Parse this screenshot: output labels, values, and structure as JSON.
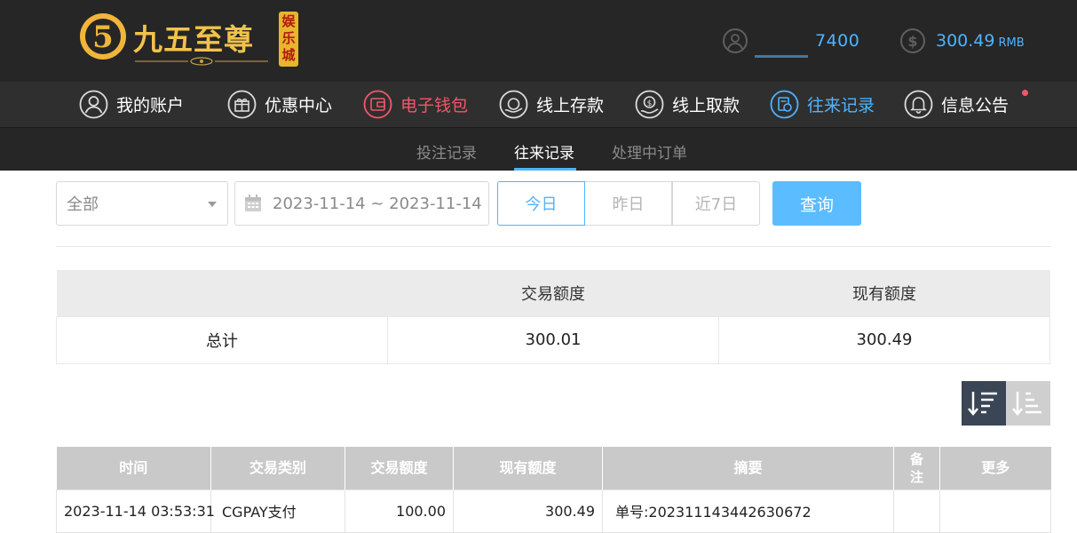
{
  "header": {
    "logo_text": "九五至尊",
    "logo_badge": "娱乐城",
    "username_visible": "7400",
    "balance": "300.49",
    "currency": "RMB"
  },
  "nav": {
    "items": [
      {
        "label": "我的账户",
        "icon": "user-circle-icon"
      },
      {
        "label": "优惠中心",
        "icon": "gift-icon"
      },
      {
        "label": "电子钱包",
        "icon": "wallet-icon",
        "color": "#f4566b"
      },
      {
        "label": "线上存款",
        "icon": "deposit-icon"
      },
      {
        "label": "线上取款",
        "icon": "withdraw-icon"
      },
      {
        "label": "往来记录",
        "icon": "records-icon",
        "color": "#4fb3ff"
      },
      {
        "label": "信息公告",
        "icon": "bell-icon"
      }
    ]
  },
  "subnav": {
    "items": [
      {
        "label": "投注记录"
      },
      {
        "label": "往来记录",
        "active": true
      },
      {
        "label": "处理中订单"
      }
    ]
  },
  "filters": {
    "type_selected": "全部",
    "date_range": "2023-11-14 ~ 2023-11-14",
    "quick_today": "今日",
    "quick_yesterday": "昨日",
    "quick_last7": "近7日",
    "query_label": "查询"
  },
  "summary": {
    "headers": [
      "",
      "交易额度",
      "现有额度"
    ],
    "row": {
      "label": "总计",
      "transaction_amount": "300.01",
      "current_amount": "300.49"
    }
  },
  "records": {
    "headers": [
      "时间",
      "交易类别",
      "交易额度",
      "现有额度",
      "摘要",
      "备注",
      "更多"
    ],
    "rows": [
      {
        "time": "2023-11-14 03:53:31",
        "type": "CGPAY支付",
        "amount": "100.00",
        "balance": "300.49",
        "summary": "单号:202311143442630672",
        "note": "",
        "more": ""
      }
    ]
  },
  "colors": {
    "accent": "#4fb3ff",
    "highlight": "#f4566b",
    "header_bg": "#262626",
    "nav_bg": "#2f2f2f",
    "query_button": "#5bbcff"
  }
}
